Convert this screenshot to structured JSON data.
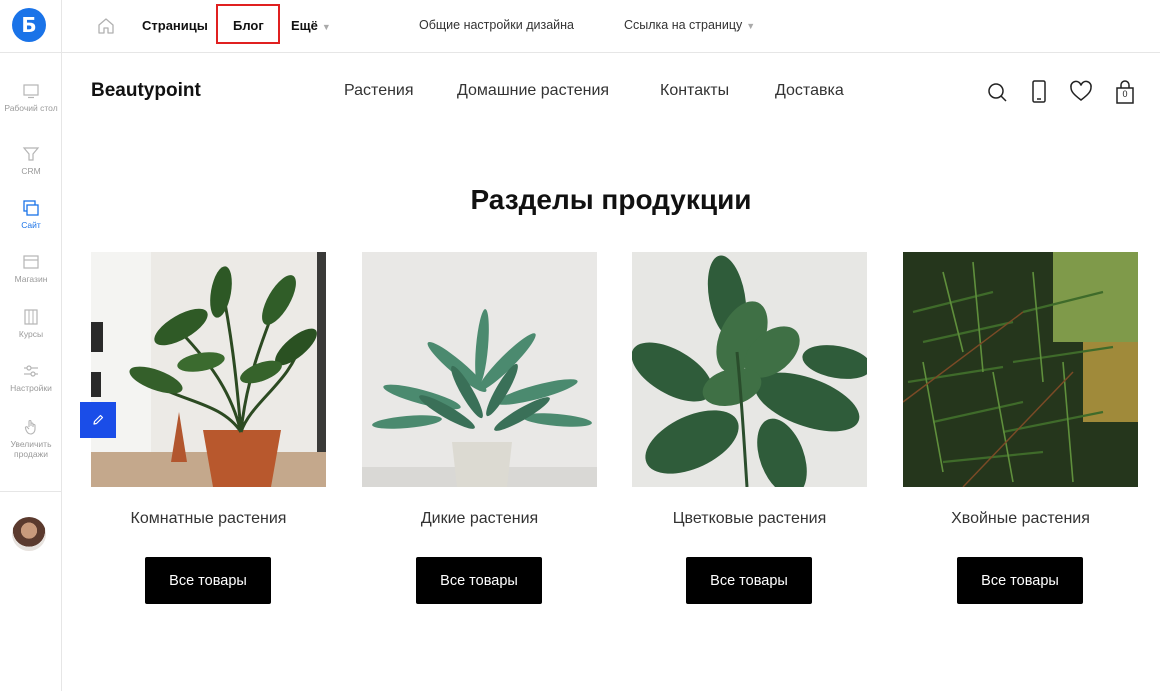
{
  "rail": {
    "logo": "Б",
    "items": [
      {
        "label": "Рабочий стол",
        "icon": "desktop-icon",
        "active": false
      },
      {
        "label": "CRM",
        "icon": "funnel-icon",
        "active": false
      },
      {
        "label": "Сайт",
        "icon": "site-icon",
        "active": true
      },
      {
        "label": "Магазин",
        "icon": "store-icon",
        "active": false
      },
      {
        "label": "Курсы",
        "icon": "courses-icon",
        "active": false
      },
      {
        "label": "Настройки",
        "icon": "settings-icon",
        "active": false
      },
      {
        "label": "Увеличить продажи",
        "icon": "hand-icon",
        "active": false
      }
    ]
  },
  "topbar": {
    "pages": "Страницы",
    "blog": "Блог",
    "more": "Ещё",
    "design_settings": "Общие настройки дизайна",
    "page_link": "Ссылка на страницу"
  },
  "site": {
    "brand": "Beautypoint",
    "nav": [
      "Растения",
      "Домашние растения",
      "Контакты",
      "Доставка"
    ],
    "cart_count": "0"
  },
  "section": {
    "title": "Разделы продукции",
    "cards": [
      {
        "title": "Комнатные растения",
        "button": "Все товары"
      },
      {
        "title": "Дикие растения",
        "button": "Все товары"
      },
      {
        "title": "Цветковые растения",
        "button": "Все товары"
      },
      {
        "title": "Хвойные растения",
        "button": "Все товары"
      }
    ]
  },
  "colors": {
    "accent": "#1a73e8",
    "highlight": "#e02020",
    "button": "#000000"
  }
}
